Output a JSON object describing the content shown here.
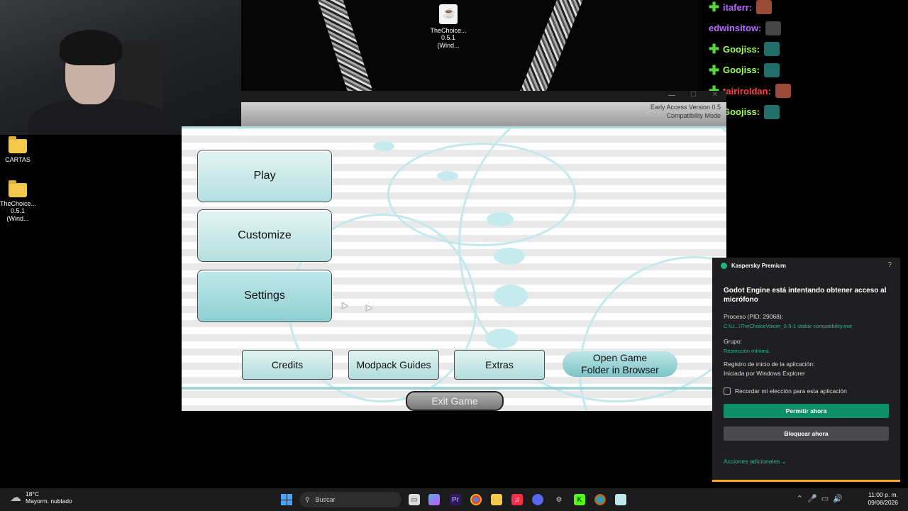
{
  "desktop": {
    "icons": [
      {
        "label": "CARTAS"
      },
      {
        "label": "TheChoice... 0.5.1 (Wind..."
      },
      {
        "label": "TheChoice... 0.5.1 (Wind..."
      }
    ]
  },
  "chat": [
    {
      "user": "itaferr:",
      "color": "#b86cff",
      "badge": true,
      "avatar": "red"
    },
    {
      "user": "edwinsitow:",
      "color": "#b86cff",
      "badge": false,
      "avatar": "dark"
    },
    {
      "user": "Goojiss:",
      "color": "#9cff5c",
      "badge": true,
      "avatar": "teal"
    },
    {
      "user": "Goojiss:",
      "color": "#9cff5c",
      "badge": true,
      "avatar": "teal"
    },
    {
      "user": "tairiroldan:",
      "color": "#ff4040",
      "badge": true,
      "avatar": "red"
    },
    {
      "user": "Goojiss:",
      "color": "#9cff5c",
      "badge": true,
      "avatar": "teal"
    }
  ],
  "game": {
    "version_line1": "Early Access Version 0.5",
    "version_line2": "Compatibility Mode",
    "buttons": {
      "play": "Play",
      "customize": "Customize",
      "settings": "Settings",
      "credits": "Credits",
      "modpack": "Modpack Guides",
      "extras": "Extras",
      "open_folder_1": "Open Game",
      "open_folder_2": "Folder in Browser",
      "exit": "Exit Game"
    }
  },
  "kaspersky": {
    "brand": "Kaspersky Premium",
    "help": "?",
    "title": "Godot Engine está intentando obtener acceso al micrófono",
    "process_label": "Proceso (PID: 29068):",
    "process_path": "C:\\U...\\TheChoiceVoicer_0-5-1 stable compatibility.exe",
    "group_label": "Grupo:",
    "group_value": "Restricción mínima",
    "registry_label": "Registro de inicio de la aplicación:",
    "registry_value": "Iniciada por Windows Explorer",
    "remember": "Recordar mi elección para esta aplicación",
    "allow": "Permitir ahora",
    "block": "Bloquear ahora",
    "more": "Acciones adicionales"
  },
  "taskbar": {
    "temp": "18°C",
    "weather": "Mayorm. nublado",
    "search_placeholder": "Buscar",
    "time": "11:00 p. m.",
    "date": "09/08/2026",
    "apps": [
      "file-explorer-icon",
      "copilot-icon",
      "premiere-icon",
      "chrome-icon",
      "folder-icon",
      "music-icon",
      "discord-icon",
      "settings-icon",
      "kick-icon",
      "chrome-icon-2",
      "notepad-icon"
    ]
  },
  "colors": {
    "accent": "#a9dde2",
    "allow_button": "#0d8f68",
    "progress": "#f5a623"
  }
}
